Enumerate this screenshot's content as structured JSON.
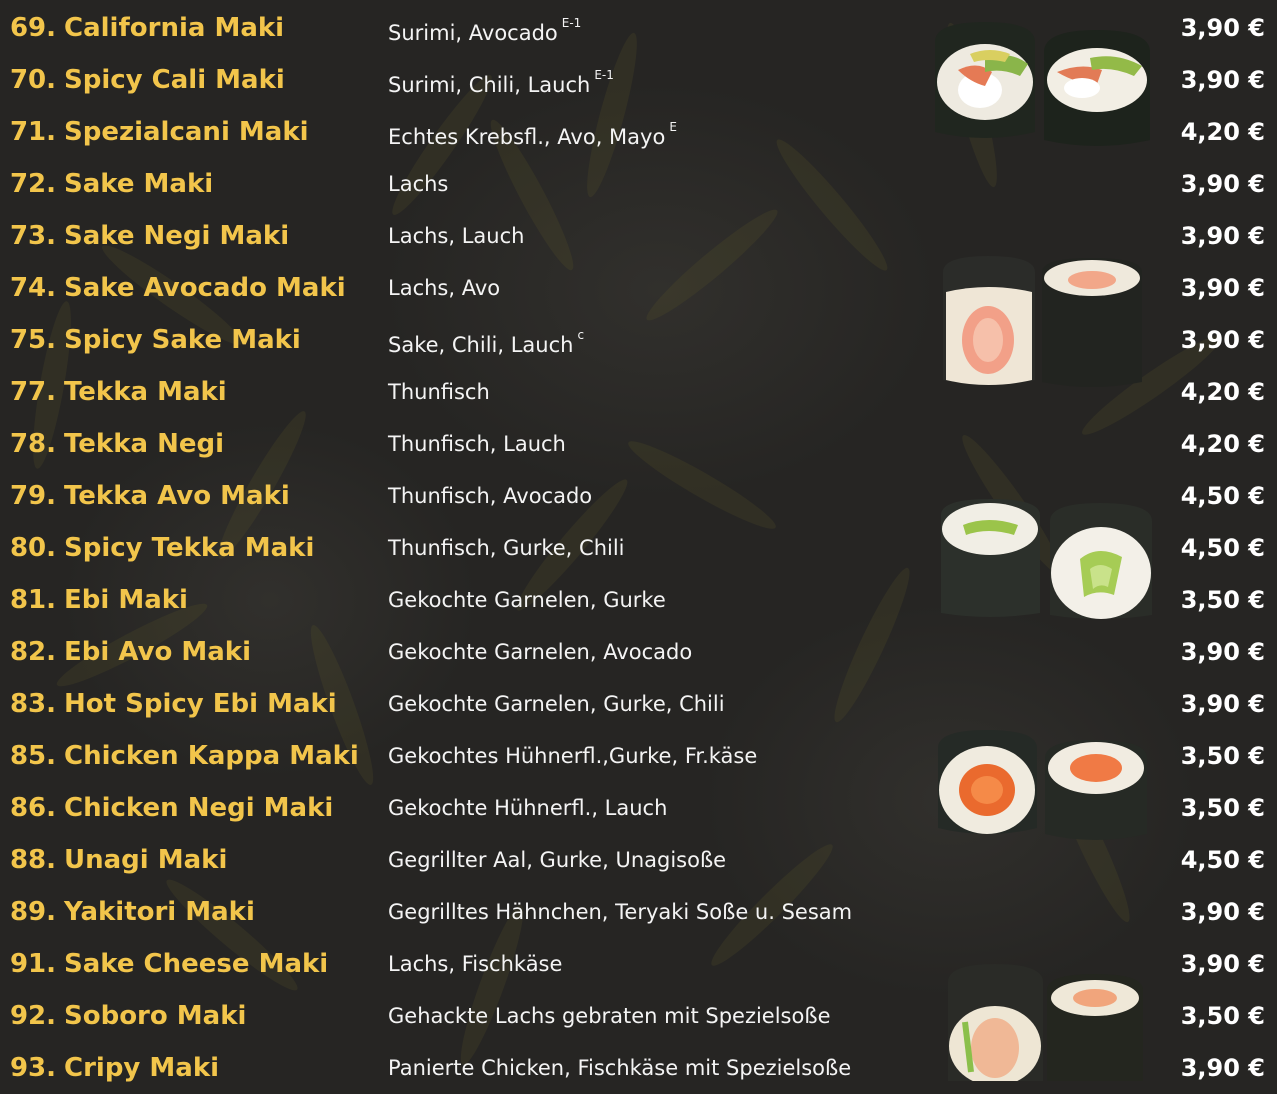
{
  "items": [
    {
      "number": "69.",
      "name": "California Maki",
      "desc": "Surimi, Avocado",
      "sup": "E-1",
      "price": "3,90 €"
    },
    {
      "number": "70.",
      "name": "Spicy Cali Maki",
      "desc": "Surimi, Chili, Lauch",
      "sup": "E-1",
      "price": "3,90 €"
    },
    {
      "number": "71.",
      "name": "Spezialcani Maki",
      "desc": "Echtes Krebsfl., Avo, Mayo",
      "sup": "E",
      "price": "4,20 €"
    },
    {
      "number": "72.",
      "name": "Sake Maki",
      "desc": "Lachs",
      "sup": "",
      "price": "3,90 €"
    },
    {
      "number": "73.",
      "name": "Sake Negi Maki",
      "desc": "Lachs, Lauch",
      "sup": "",
      "price": "3,90 €"
    },
    {
      "number": "74.",
      "name": "Sake Avocado Maki",
      "desc": "Lachs, Avo",
      "sup": "",
      "price": "3,90 €"
    },
    {
      "number": "75.",
      "name": "Spicy Sake Maki",
      "desc": "Sake, Chili, Lauch",
      "sup": "c",
      "price": "3,90 €"
    },
    {
      "number": "77.",
      "name": "Tekka Maki",
      "desc": "Thunfisch",
      "sup": "",
      "price": "4,20 €"
    },
    {
      "number": "78.",
      "name": "Tekka Negi",
      "desc": "Thunfisch, Lauch",
      "sup": "",
      "price": "4,20 €"
    },
    {
      "number": "79.",
      "name": "Tekka Avo Maki",
      "desc": "Thunfisch, Avocado",
      "sup": "",
      "price": "4,50 €"
    },
    {
      "number": "80.",
      "name": "Spicy Tekka Maki",
      "desc": "Thunfisch, Gurke, Chili",
      "sup": "",
      "price": "4,50 €"
    },
    {
      "number": "81.",
      "name": "Ebi Maki",
      "desc": "Gekochte Garnelen, Gurke",
      "sup": "",
      "price": "3,50 €"
    },
    {
      "number": "82.",
      "name": "Ebi Avo Maki",
      "desc": "Gekochte Garnelen, Avocado",
      "sup": "",
      "price": "3,90 €"
    },
    {
      "number": "83.",
      "name": "Hot Spicy Ebi Maki",
      "desc": "Gekochte Garnelen, Gurke, Chili",
      "sup": "",
      "price": "3,90 €"
    },
    {
      "number": "85.",
      "name": "Chicken Kappa Maki",
      "desc": "Gekochtes Hühnerfl.,Gurke, Fr.käse",
      "sup": "",
      "price": "3,50 €"
    },
    {
      "number": "86.",
      "name": "Chicken Negi Maki",
      "desc": "Gekochte Hühnerfl., Lauch",
      "sup": "",
      "price": "3,50 €"
    },
    {
      "number": "88.",
      "name": "Unagi Maki",
      "desc": "Gegrillter Aal, Gurke, Unagisoße",
      "sup": "",
      "price": "4,50 €"
    },
    {
      "number": "89.",
      "name": "Yakitori Maki",
      "desc": "Gegrilltes Hähnchen, Teryaki Soße u. Sesam",
      "sup": "",
      "price": "3,90 €"
    },
    {
      "number": "91.",
      "name": "Sake Cheese Maki",
      "desc": "Lachs, Fischkäse",
      "sup": "",
      "price": "3,90 €"
    },
    {
      "number": "92.",
      "name": "Soboro Maki",
      "desc": "Gehackte Lachs gebraten mit Spezielsoße",
      "sup": "",
      "price": "3,50 €"
    },
    {
      "number": "93.",
      "name": "Cripy Maki",
      "desc": "Panierte Chicken, Fischkäse mit Spezielsoße",
      "sup": "",
      "price": "3,90 €"
    }
  ],
  "photos": [
    "california-maki-photo",
    "shrimp-maki-photo",
    "cucumber-maki-photo",
    "salmon-maki-photo",
    "crispy-maki-photo"
  ],
  "colors": {
    "background": "#262523",
    "name": "#f2c54b",
    "description": "#f4f4f4",
    "price": "#ffffff"
  }
}
